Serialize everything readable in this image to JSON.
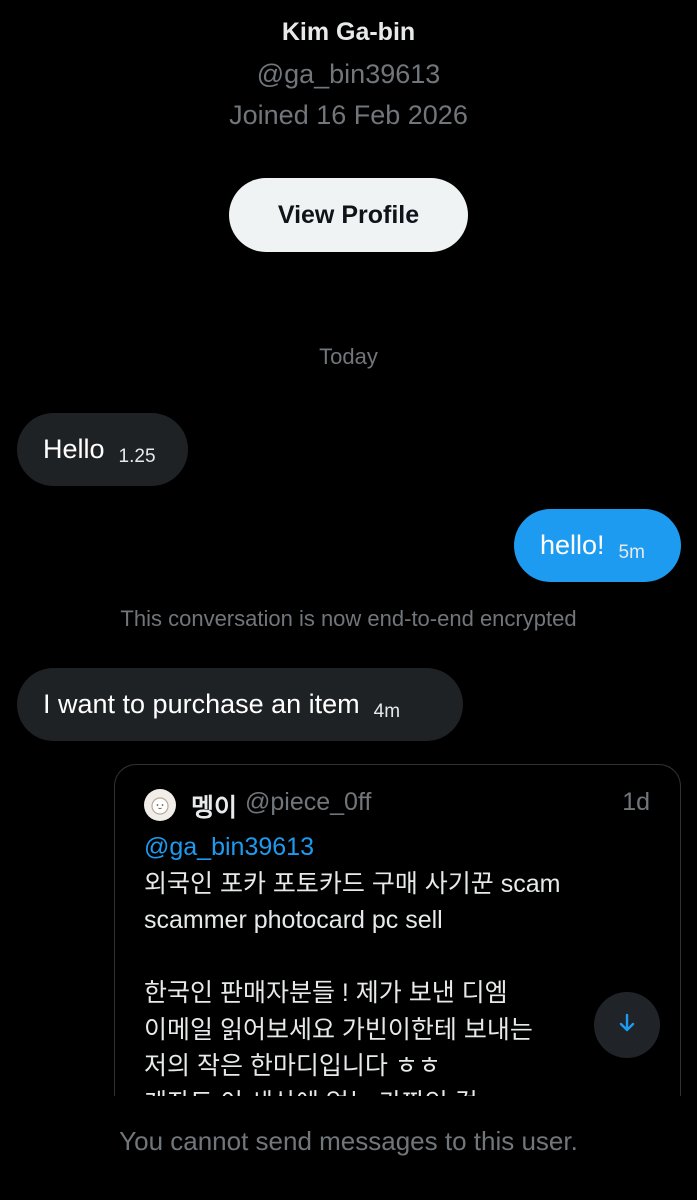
{
  "profile": {
    "display_name": "Kim Ga-bin",
    "handle": "@ga_bin39613",
    "joined": "Joined 16 Feb 2026",
    "view_profile_label": "View Profile"
  },
  "conversation": {
    "day_separator": "Today",
    "encryption_notice": "This conversation is now end-to-end encrypted",
    "messages": [
      {
        "direction": "incoming",
        "text": "Hello",
        "time": "1.25"
      },
      {
        "direction": "outgoing",
        "text": "hello!",
        "time": "5m"
      },
      {
        "direction": "incoming",
        "text": "I want to purchase an item",
        "time": "4m"
      }
    ]
  },
  "quoted_post": {
    "author_name": "멩이",
    "author_handle": "@piece_0ff",
    "time": "1d",
    "mention": "@ga_bin39613",
    "lines": [
      "외국인 포카 포토카드 구매 사기꾼 scam",
      "scammer photocard pc sell",
      "",
      "한국인 판매자분들 ! 제가 보낸 디엠",
      "이메일 읽어보세요 가빈이한테 보내는",
      "저의 작은 한마디입니다 ㅎㅎ",
      "계좌도 이 세상에 없는 가짜인 걸"
    ]
  },
  "footer": {
    "notice": "You cannot send messages to this user."
  },
  "colors": {
    "background": "#000000",
    "accent": "#1d9bf0",
    "incoming_bubble": "#1f2225",
    "muted_text": "#71767b"
  },
  "icons": {
    "scroll_down": "arrow-down-icon",
    "quoted_avatar": "avatar-icon"
  }
}
